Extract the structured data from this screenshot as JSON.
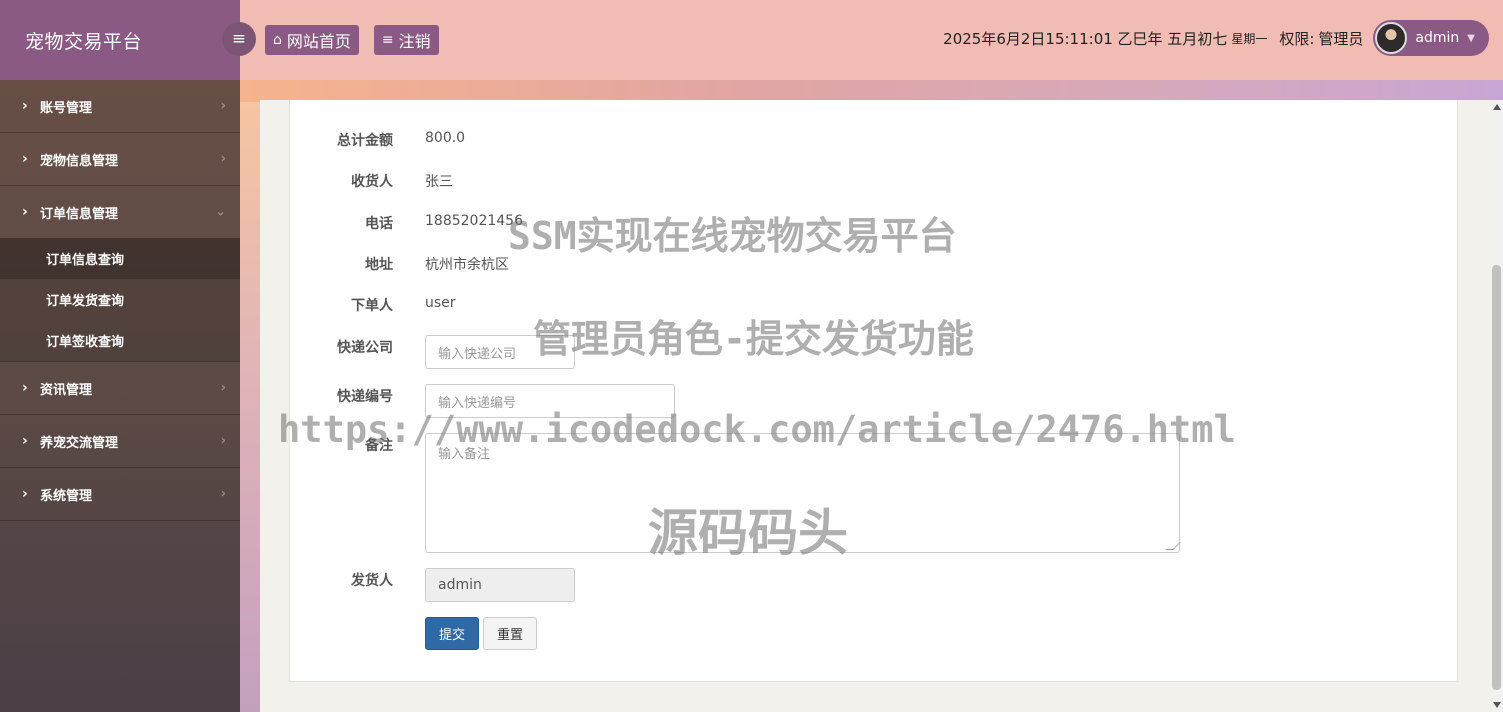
{
  "app": {
    "title": "宠物交易平台"
  },
  "topbar": {
    "home_label": "网站首页",
    "logout_label": "注销",
    "datetime": "2025年6月2日15:11:01 乙巳年 五月初七",
    "weekday": "星期一",
    "role_label": "权限:",
    "role_value": "管理员",
    "username": "admin"
  },
  "sidebar": {
    "groups": [
      {
        "label": "账号管理"
      },
      {
        "label": "宠物信息管理"
      },
      {
        "label": "订单信息管理",
        "subs": [
          "订单信息查询",
          "订单发货查询",
          "订单签收查询"
        ]
      },
      {
        "label": "资讯管理"
      },
      {
        "label": "养宠交流管理"
      },
      {
        "label": "系统管理"
      }
    ]
  },
  "form": {
    "total_label": "总计金额",
    "total_value": "800.0",
    "receiver_label": "收货人",
    "receiver_value": "张三",
    "phone_label": "电话",
    "phone_value": "18852021456",
    "address_label": "地址",
    "address_value": "杭州市余杭区",
    "orderer_label": "下单人",
    "orderer_value": "user",
    "express_company_label": "快递公司",
    "express_company_placeholder": "输入快递公司",
    "express_no_label": "快递编号",
    "express_no_placeholder": "输入快递编号",
    "remark_label": "备注",
    "remark_placeholder": "输入备注",
    "shipper_label": "发货人",
    "shipper_value": "admin",
    "submit_label": "提交",
    "reset_label": "重置"
  },
  "watermark": {
    "line1": "SSM实现在线宠物交易平台",
    "line2": "管理员角色-提交发货功能",
    "line3": "https://www.icodedock.com/article/2476.html",
    "line4": "源码码头"
  },
  "colors": {
    "sidebar_brand": "#8a5a84",
    "topbar": "#f0bcb3",
    "primary": "#2f6aa7"
  }
}
